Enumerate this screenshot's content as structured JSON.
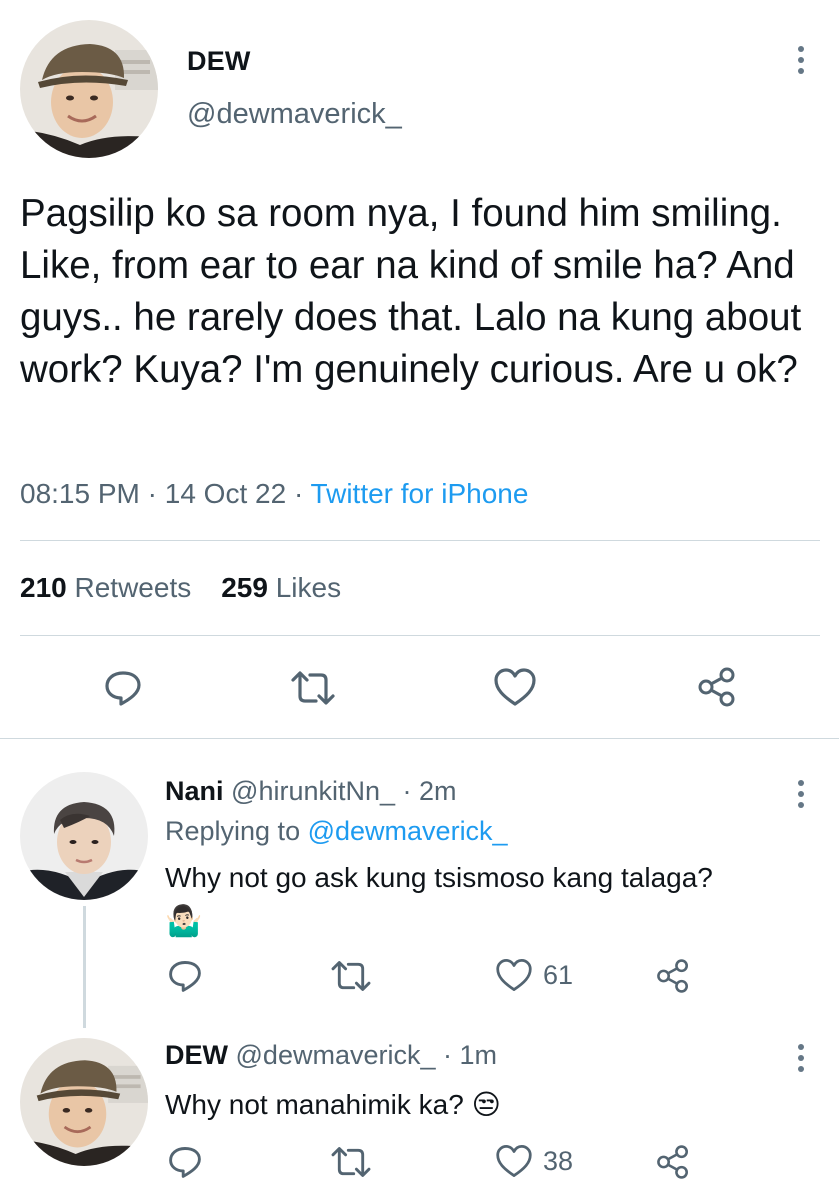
{
  "main_tweet": {
    "name": "DEW",
    "handle": "@dewmaverick_",
    "text": "Pagsilip ko sa room nya, I found him smiling. Like, from ear to ear na kind of smile ha? And guys.. he rarely does that. Lalo na kung about work? Kuya? I'm genuinely curious. Are u ok?",
    "time": "08:15 PM",
    "date": "14 Oct 22",
    "source": "Twitter for iPhone",
    "sep": "·",
    "retweets_count": "210",
    "retweets_label": "Retweets",
    "likes_count": "259",
    "likes_label": "Likes"
  },
  "replies": [
    {
      "name": "Nani",
      "handle": "@hirunkitNn_",
      "time": "· 2m",
      "replying_prefix": "Replying to",
      "replying_to": "@dewmaverick_",
      "text": "Why not go ask kung tsismoso kang talaga?",
      "emoji": "🤷🏻‍♂️",
      "likes": "61"
    },
    {
      "name": "DEW",
      "handle": "@dewmaverick_",
      "time": "· 1m",
      "text": "Why not manahimik ka?",
      "emoji": "😒",
      "likes": "38"
    }
  ],
  "icons": [
    "more-vertical-icon",
    "reply-icon",
    "retweet-icon",
    "like-icon",
    "share-icon"
  ],
  "colors": {
    "link": "#1d9bf0",
    "secondary_text": "#536471",
    "divider": "#cfd9de"
  }
}
